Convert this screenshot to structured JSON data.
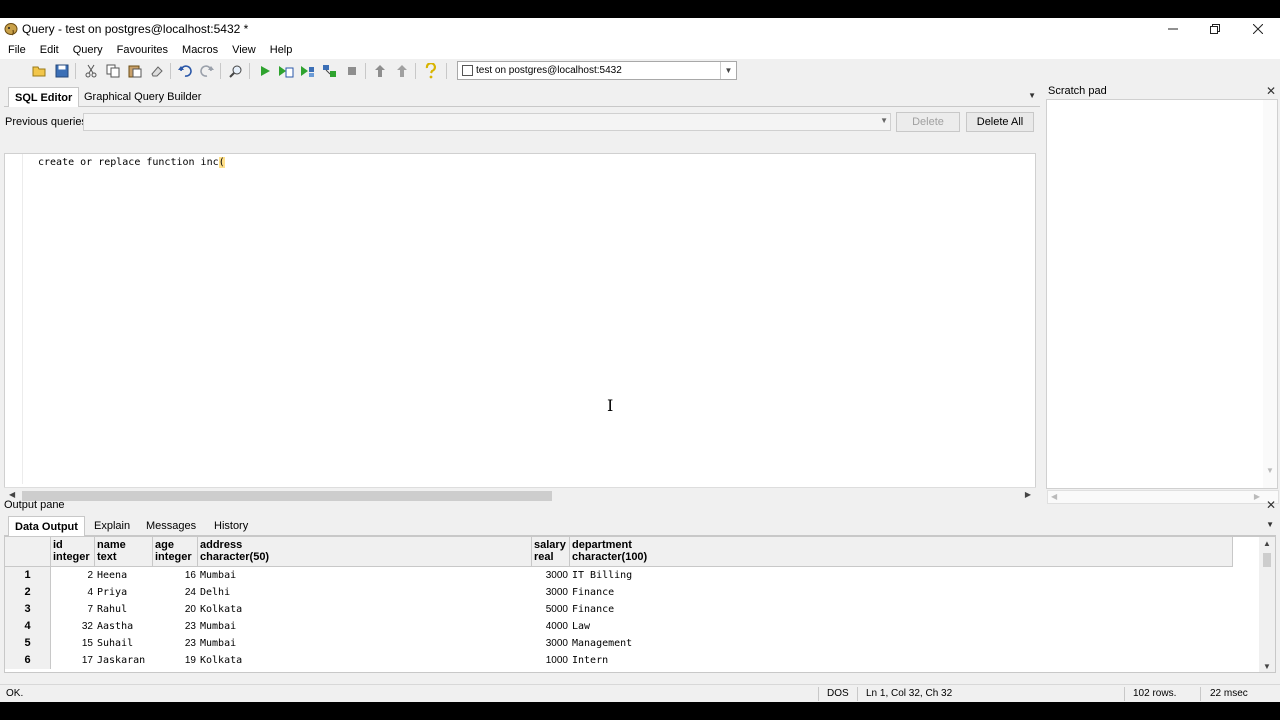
{
  "window": {
    "title": "Query - test on postgres@localhost:5432 *"
  },
  "menu": [
    "File",
    "Edit",
    "Query",
    "Favourites",
    "Macros",
    "View",
    "Help"
  ],
  "toolbar": {
    "connection": "test on postgres@localhost:5432"
  },
  "editor": {
    "tabs": [
      "SQL Editor",
      "Graphical Query Builder"
    ],
    "previous_queries_label": "Previous queries",
    "delete_label": "Delete",
    "delete_all_label": "Delete All",
    "code_before_caret": "create or replace function inc",
    "caret_char": "("
  },
  "scratch_pad": {
    "title": "Scratch pad"
  },
  "output": {
    "title": "Output pane",
    "tabs": [
      "Data Output",
      "Explain",
      "Messages",
      "History"
    ],
    "columns": [
      {
        "name": "id",
        "type": "integer"
      },
      {
        "name": "name",
        "type": "text"
      },
      {
        "name": "age",
        "type": "integer"
      },
      {
        "name": "address",
        "type": "character(50)"
      },
      {
        "name": "salary",
        "type": "real"
      },
      {
        "name": "department",
        "type": "character(100)"
      }
    ],
    "rows": [
      {
        "n": "1",
        "id": "2",
        "name": "Heena",
        "age": "16",
        "address": "Mumbai",
        "salary": "3000",
        "department": "IT Billing"
      },
      {
        "n": "2",
        "id": "4",
        "name": "Priya",
        "age": "24",
        "address": "Delhi",
        "salary": "3000",
        "department": "Finance"
      },
      {
        "n": "3",
        "id": "7",
        "name": "Rahul",
        "age": "20",
        "address": "Kolkata",
        "salary": "5000",
        "department": "Finance"
      },
      {
        "n": "4",
        "id": "32",
        "name": "Aastha",
        "age": "23",
        "address": "Mumbai",
        "salary": "4000",
        "department": "Law"
      },
      {
        "n": "5",
        "id": "15",
        "name": "Suhail",
        "age": "23",
        "address": "Mumbai",
        "salary": "3000",
        "department": "Management"
      },
      {
        "n": "6",
        "id": "17",
        "name": "Jaskaran",
        "age": "19",
        "address": "Kolkata",
        "salary": "1000",
        "department": "Intern"
      }
    ]
  },
  "status": {
    "message": "OK.",
    "line_ending": "DOS",
    "position": "Ln 1, Col 32, Ch 32",
    "rows": "102 rows.",
    "time": "22 msec"
  }
}
